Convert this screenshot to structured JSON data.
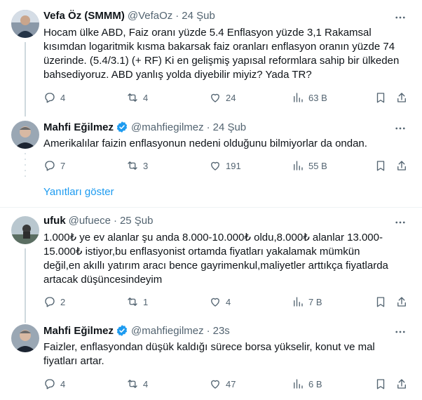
{
  "tweets": [
    {
      "name": "Vefa Öz (SMMM)",
      "handle": "@VefaOz",
      "separator": "·",
      "time": "24 Şub",
      "verified": false,
      "lines": [
        "Hocam ülke ABD, Faiz oranı yüzde 5.4  Enflasyon  yüzde 3,1  Rakamsal",
        "kısımdan logaritmik kısma bakarsak faiz oranları enflasyon oranın yüzde 74",
        "üzerinde. (5.4/3.1) (+ RF) Ki en gelişmiş yapısal reformlara sahip bir ülkeden",
        "bahsediyoruz. ABD yanlış yolda diyebilir miyiz? Yada TR?"
      ],
      "replies": "4",
      "reposts": "4",
      "likes": "24",
      "views": "63 B"
    },
    {
      "name": "Mahfi Eğilmez",
      "handle": "@mahfiegilmez",
      "separator": "·",
      "time": "24 Şub",
      "verified": true,
      "lines": [
        "Amerikalılar faizin enflasyonun nedeni olduğunu bilmiyorlar da ondan."
      ],
      "replies": "7",
      "reposts": "3",
      "likes": "191",
      "views": "55 B"
    },
    {
      "name": "ufuk",
      "handle": "@ufuece",
      "separator": "·",
      "time": "25 Şub",
      "verified": false,
      "lines": [
        "1.000₺ ye ev alanlar şu anda 8.000-10.000₺ oldu,8.000₺ alanlar 13.000-",
        "15.000₺ istiyor,bu enflasyonist ortamda  fiyatları yakalamak mümkün",
        "değil,en akıllı yatırım aracı bence gayrimenkul,maliyetler arttıkça fiyatlarda",
        "artacak düşüncesindeyim"
      ],
      "replies": "2",
      "reposts": "1",
      "likes": "4",
      "views": "7 B"
    },
    {
      "name": "Mahfi Eğilmez",
      "handle": "@mahfiegilmez",
      "separator": "·",
      "time": "23s",
      "verified": true,
      "lines": [
        "Faizler, enflasyondan düşük kaldığı sürece borsa yükselir, konut ve mal",
        "fiyatları artar."
      ],
      "replies": "4",
      "reposts": "4",
      "likes": "47",
      "views": "6 B"
    }
  ],
  "show_replies_label": "Yanıtları göster",
  "colors": {
    "accent": "#1d9bf0",
    "muted": "#536471",
    "text": "#0f1419",
    "border": "#eff3f4"
  },
  "icons": [
    "more-icon",
    "verified-badge-icon",
    "reply-icon",
    "repost-icon",
    "like-icon",
    "views-icon",
    "bookmark-icon",
    "share-icon"
  ]
}
